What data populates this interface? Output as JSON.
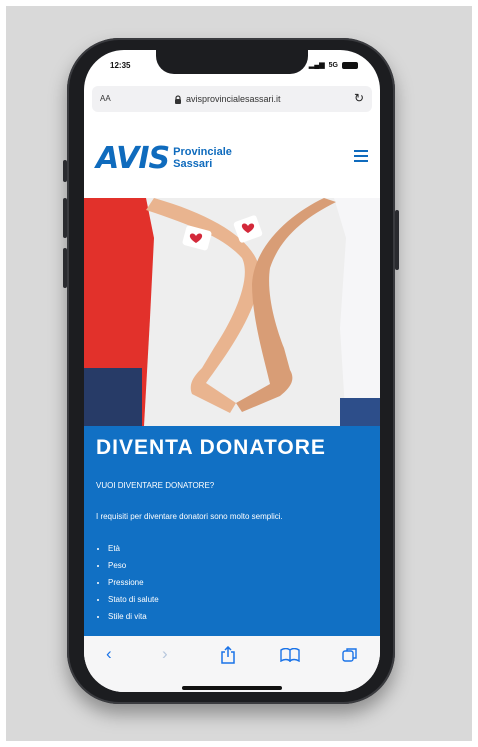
{
  "status": {
    "time": "12:35",
    "network": "5G"
  },
  "browser": {
    "text_size": "AA",
    "url": "avisprovincialesassari.it"
  },
  "site": {
    "logo_mark": "AVIS",
    "logo_line1": "Provinciale",
    "logo_line2": "Sassari",
    "section_title": "DIVENTA DONATORE",
    "question": "VUOI DIVENTARE DONATORE?",
    "requirements_text": "I requisiti per diventare donatori sono molto semplici.",
    "requirements": [
      "Età",
      "Peso",
      "Pressione",
      "Stato di salute",
      "Stile di vita"
    ]
  },
  "colors": {
    "brand": "#1170c4",
    "background": "#d9d9d9"
  }
}
